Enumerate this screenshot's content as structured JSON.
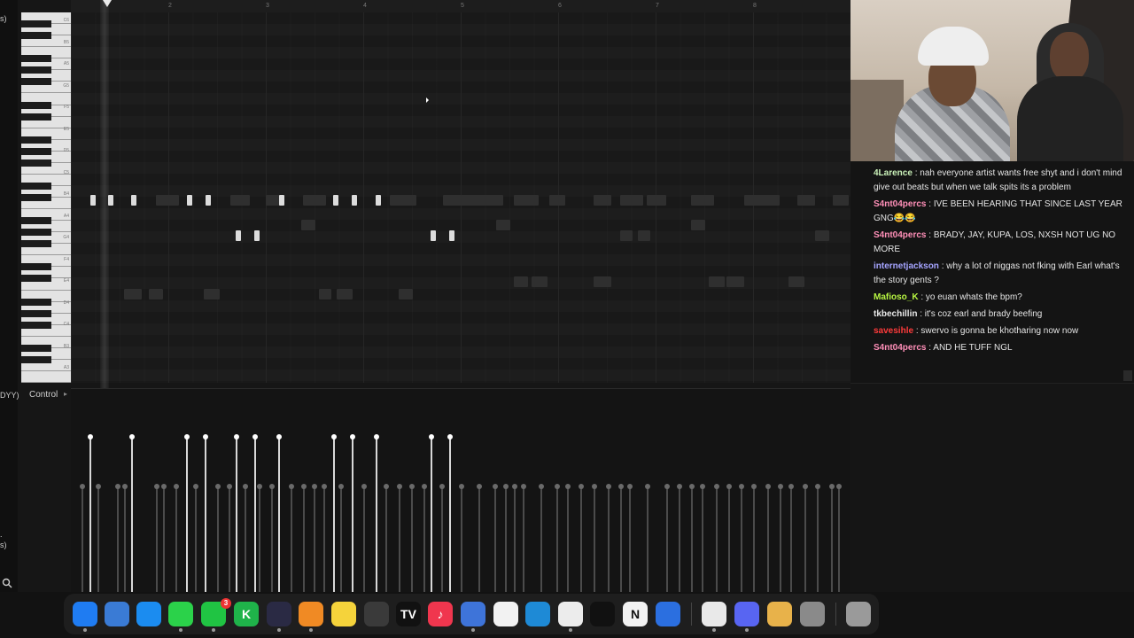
{
  "left_strip": {
    "top_fragment": "s)",
    "mid_fragment": "DYY)",
    "lower_fragment_1": ".",
    "lower_fragment_2": "s)"
  },
  "piano_roll": {
    "ruler_bars": [
      "2",
      "3",
      "4",
      "5",
      "6",
      "7",
      "8"
    ],
    "key_labels": [
      "C6",
      "B5",
      "A5",
      "G5",
      "F5",
      "E5",
      "D5",
      "C5",
      "B4",
      "A4",
      "G4",
      "F4",
      "E4",
      "D4",
      "C4",
      "B3",
      "A3"
    ]
  },
  "control": {
    "label": "Control",
    "arrow": "▸"
  },
  "chat": {
    "messages": [
      {
        "user": "4Larence",
        "color": "#c9f0b8",
        "text": "nah everyone artist wants free shyt and i don't mind give out beats but when we talk spits its a problem"
      },
      {
        "user": "S4nt04percs",
        "color": "#ff8fb8",
        "text": "IVE BEEN HEARING THAT SINCE LAST YEAR GNG😂😂"
      },
      {
        "user": "S4nt04percs",
        "color": "#ff8fb8",
        "text": "BRADY, JAY, KUPA, LOS, NXSH NOT UG NO MORE"
      },
      {
        "user": "internetjackson",
        "color": "#a5a4ff",
        "text": "why a lot of niggas not fking with Earl what's the story gents ?"
      },
      {
        "user": "Mafioso_K",
        "color": "#b7f542",
        "text": "yo euan whats the bpm?"
      },
      {
        "user": "tkbechillin",
        "color": "#e8e8e8",
        "text": "it's coz earl and brady beefing"
      },
      {
        "user": "savesihle",
        "color": "#ff3b3b",
        "text": "swervo is gonna be khotharing now now"
      },
      {
        "user": "S4nt04percs",
        "color": "#ff8fb8",
        "text": "AND HE TUFF NGL"
      }
    ]
  },
  "dock": {
    "apps": [
      {
        "name": "finder-icon",
        "glyph": "",
        "bg": "#1f7cf2"
      },
      {
        "name": "preview-icon",
        "glyph": "",
        "bg": "#3a7bd5"
      },
      {
        "name": "safari-icon",
        "glyph": "",
        "bg": "#1b8cf0"
      },
      {
        "name": "messages-icon",
        "glyph": "",
        "bg": "#2bd24a"
      },
      {
        "name": "facetime-icon",
        "glyph": "",
        "bg": "#20c443",
        "badge": "3"
      },
      {
        "name": "kite-icon",
        "glyph": "K",
        "bg": "#1fb34a"
      },
      {
        "name": "obs-icon",
        "glyph": "",
        "bg": "#2a2a44"
      },
      {
        "name": "fl-studio-icon",
        "glyph": "",
        "bg": "#f08a24"
      },
      {
        "name": "notes-icon",
        "glyph": "",
        "bg": "#f5d33b"
      },
      {
        "name": "pen-icon",
        "glyph": "",
        "bg": "#3a3a3a"
      },
      {
        "name": "tradingview-icon",
        "glyph": "TV",
        "bg": "#111111"
      },
      {
        "name": "music-icon",
        "glyph": "♪",
        "bg": "#f0364e"
      },
      {
        "name": "davinci-icon",
        "glyph": "",
        "bg": "#3e74d9"
      },
      {
        "name": "github-icon",
        "glyph": "",
        "bg": "#f2f2f2"
      },
      {
        "name": "vscode-icon",
        "glyph": "",
        "bg": "#1e8ad6"
      },
      {
        "name": "chatgpt-icon",
        "glyph": "",
        "bg": "#ececec"
      },
      {
        "name": "capcut-icon",
        "glyph": "",
        "bg": "#111111"
      },
      {
        "name": "notion-icon",
        "glyph": "N",
        "bg": "#f2f2f2"
      },
      {
        "name": "app-icon-blue",
        "glyph": "",
        "bg": "#2b6fe0"
      },
      {
        "name": "chrome-icon",
        "glyph": "",
        "bg": "#e9e9e9"
      },
      {
        "name": "discord-icon",
        "glyph": "",
        "bg": "#5865f2"
      },
      {
        "name": "utilities-icon",
        "glyph": "",
        "bg": "#e8b24a"
      },
      {
        "name": "system-settings-icon",
        "glyph": "",
        "bg": "#8a8a8a"
      },
      {
        "name": "trash-icon",
        "glyph": "",
        "bg": "#9a9a9a"
      }
    ]
  }
}
